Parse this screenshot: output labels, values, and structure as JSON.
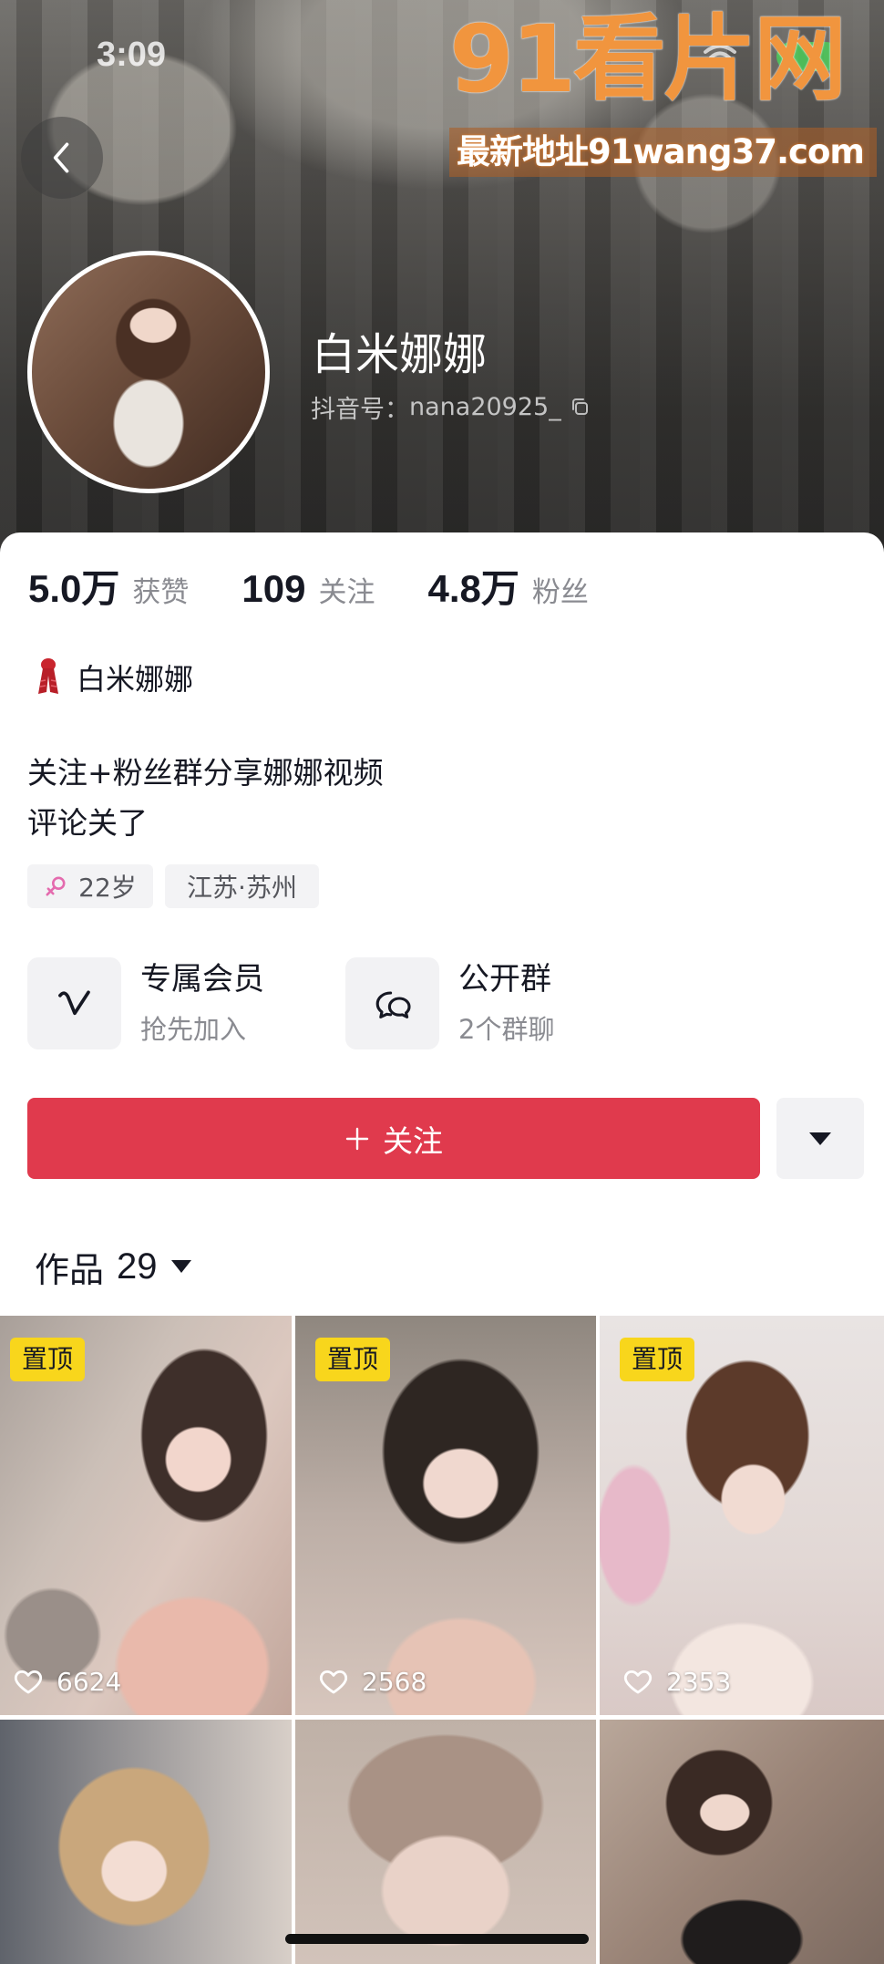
{
  "status_bar": {
    "time": "3:09",
    "wifi_icon": "wifi-icon",
    "battery_icon": "battery-icon"
  },
  "watermark": {
    "logo": "91看片网",
    "address": "最新地址91wang37.com"
  },
  "header": {
    "back_icon": "chevron-left-icon",
    "name": "白米娜娜",
    "id_label": "抖音号：",
    "id_value": "nana20925_",
    "copy_icon": "copy-icon"
  },
  "stats": [
    {
      "value": "5.0万",
      "label": "获赞"
    },
    {
      "value": "109",
      "label": "关注"
    },
    {
      "value": "4.8万",
      "label": "粉丝"
    }
  ],
  "profile_tag": {
    "icon": "scarf-icon",
    "text": "白米娜娜"
  },
  "bio": {
    "line1": "关注+粉丝群分享娜娜视频",
    "line2": "评论关了"
  },
  "chips": [
    {
      "icon": "female-icon",
      "text": "22岁"
    },
    {
      "text": "江苏·苏州"
    }
  ],
  "features": [
    {
      "icon": "member-v-icon",
      "title": "专属会员",
      "subtitle": "抢先加入"
    },
    {
      "icon": "group-chat-icon",
      "title": "公开群",
      "subtitle": "2个群聊"
    }
  ],
  "actions": {
    "follow_icon": "plus-icon",
    "follow_label": "关注",
    "more_icon": "triangle-down-icon"
  },
  "works": {
    "label": "作品",
    "count": "29",
    "sort_icon": "triangle-down-icon"
  },
  "videos": [
    {
      "pinned": "置顶",
      "likes": "6624"
    },
    {
      "pinned": "置顶",
      "likes": "2568"
    },
    {
      "pinned": "置顶",
      "likes": "2353"
    }
  ],
  "colors": {
    "follow_button": "#e03a4d",
    "pinned_badge": "#f8d61c",
    "female_icon": "#e46bae",
    "secondary_text": "#8a8b91",
    "watermark": "#f08c2e"
  }
}
